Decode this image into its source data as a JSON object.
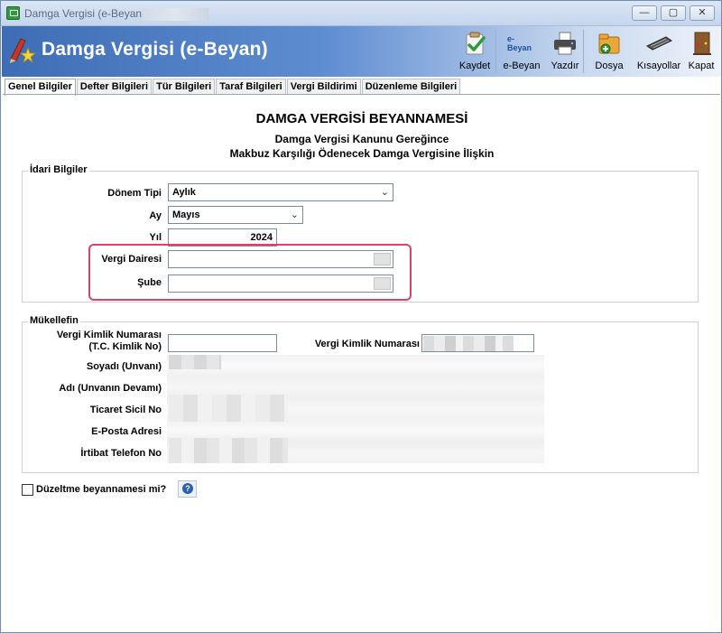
{
  "window": {
    "title": "Damga Vergisi (e-Beyan)",
    "controls": {
      "minimize": "—",
      "maximize": "▢",
      "close": "✕"
    }
  },
  "header": {
    "title": "Damga Vergisi (e-Beyan)",
    "accent_color": "#3f6db5"
  },
  "toolbar": {
    "items": [
      {
        "label": "Kaydet",
        "icon": "save-check-icon"
      },
      {
        "label": "e-Beyan",
        "icon": "e-beyan-icon"
      },
      {
        "label": "Yazdır",
        "icon": "printer-icon"
      },
      {
        "label": "Dosya",
        "icon": "file-icon"
      },
      {
        "label": "Kısayollar",
        "icon": "keyboard-icon"
      },
      {
        "label": "Kapat",
        "icon": "exit-door-icon"
      }
    ],
    "ebeyan_icon_text": "e-Beyan"
  },
  "tabs": [
    {
      "label": "Genel Bilgiler",
      "active": true
    },
    {
      "label": "Defter Bilgileri"
    },
    {
      "label": "Tür Bilgileri"
    },
    {
      "label": "Taraf Bilgileri"
    },
    {
      "label": "Vergi Bildirimi"
    },
    {
      "label": "Düzenleme Bilgileri"
    }
  ],
  "form": {
    "title": "DAMGA VERGİSİ BEYANNAMESİ",
    "subtitle1": "Damga Vergisi Kanunu Gereğince",
    "subtitle2": "Makbuz Karşılığı Ödenecek Damga Vergisine İlişkin"
  },
  "idari": {
    "group_label": "İdari Bilgiler",
    "donem_tipi_label": "Dönem Tipi",
    "donem_tipi_value": "Aylık",
    "ay_label": "Ay",
    "ay_value": "Mayıs",
    "yil_label": "Yıl",
    "yil_value": "2024",
    "vergi_dairesi_label": "Vergi Dairesi",
    "vergi_dairesi_value": "",
    "sube_label": "Şube",
    "sube_value": "",
    "highlight_color": "#d9426c"
  },
  "mukellef": {
    "group_label": "Mükellefin",
    "tc_label_line1": "Vergi Kimlik Numarası",
    "tc_label_line2": "(T.C. Kimlik No)",
    "tc_value": "",
    "vkn_label": "Vergi Kimlik Numarası",
    "soyadi_label": "Soyadı (Unvanı)",
    "adi_label": "Adı (Unvanın Devamı)",
    "ticaret_label": "Ticaret Sicil No",
    "eposta_label": "E-Posta Adresi",
    "telefon_label": "İrtibat Telefon No"
  },
  "duzeltme": {
    "label": "Düzeltme beyannamesi mi?",
    "checked": false
  }
}
